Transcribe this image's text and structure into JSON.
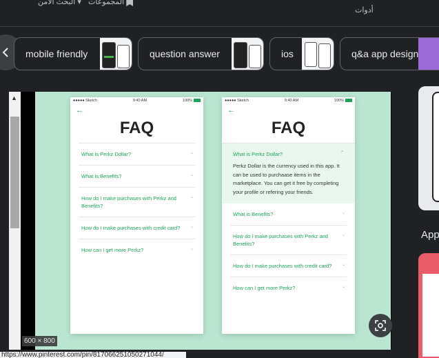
{
  "header": {
    "collections": "المجموعات",
    "safe_search": "البحث الآمن",
    "tools": "أدوات"
  },
  "chips": [
    {
      "label": "mobile friendly"
    },
    {
      "label": "question answer"
    },
    {
      "label": "ios"
    },
    {
      "label": "q&a app design"
    }
  ],
  "viewer": {
    "size_badge": "600 × 800",
    "url": "https://www.pinterest.com/pin/817066251050271044/"
  },
  "phone1": {
    "status_left": "●●●●● Sketch",
    "time": "9:40 AM",
    "battery": "100%",
    "title": "FAQ",
    "items": [
      {
        "q": "What is Perkz Dollar?"
      },
      {
        "q": "What is Benefits?"
      },
      {
        "q": "How do I make purchases with Perkz and Benefits?"
      },
      {
        "q": "How do I make purchases with credit card?"
      },
      {
        "q": "How can I get more Perkz?"
      }
    ]
  },
  "phone2": {
    "status_left": "●●●●● Sketch",
    "time": "9:40 AM",
    "battery": "100%",
    "title": "FAQ",
    "open_item": {
      "q": "What is Perkz Dollar?",
      "a": "Perkz Dollar is the currency used in this app. It can be used to purchaase items in the marketplace. You can get it free by completing your profile or refering your friends."
    },
    "items": [
      {
        "q": "What is Benefits?"
      },
      {
        "q": "How do I make purchases with Perkz and Benefits?"
      },
      {
        "q": "How do I make purchases with credit card?"
      },
      {
        "q": "How can I get more Perkz?"
      }
    ]
  },
  "side": {
    "label": "App"
  },
  "colors": {
    "mint": "#b9e5d1",
    "green": "#1fa35b",
    "dark_bg": "#202124"
  }
}
